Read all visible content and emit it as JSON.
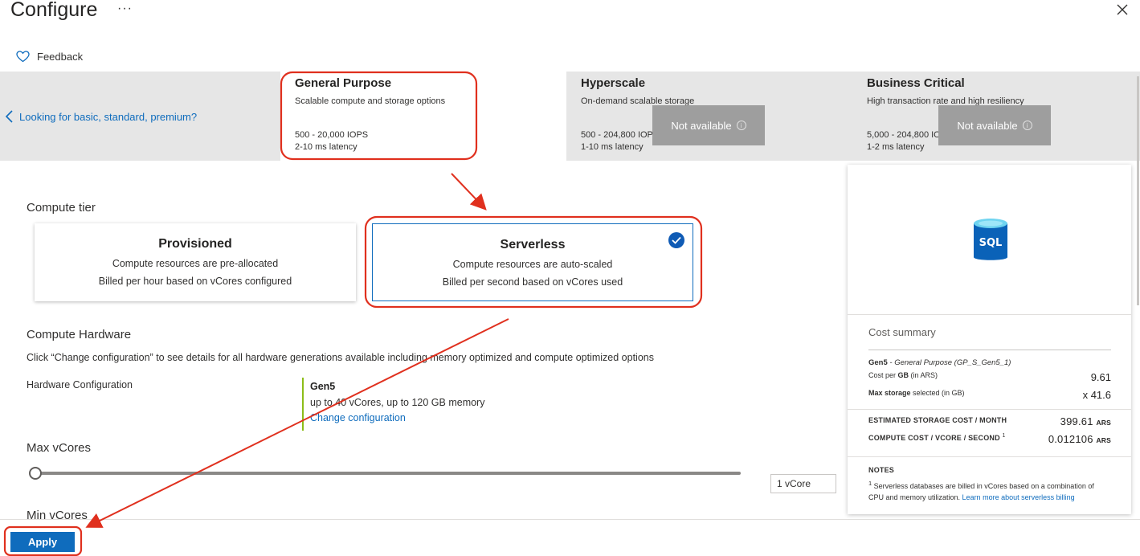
{
  "header": {
    "title": "Configure",
    "more": "···",
    "feedback": "Feedback"
  },
  "tiers": {
    "back_link": "Looking for basic, standard, premium?",
    "items": [
      {
        "name": "General Purpose",
        "desc": "Scalable compute and storage options",
        "iops": "500 - 20,000 IOPS",
        "latency": "2-10 ms latency"
      },
      {
        "name": "Hyperscale",
        "desc": "On-demand scalable storage",
        "iops": "500 - 204,800 IOPS",
        "latency": "1-10 ms latency",
        "status": "Not available"
      },
      {
        "name": "Business Critical",
        "desc": "High transaction rate and high resiliency",
        "iops": "5,000 - 204,800 IOPS",
        "latency": "1-2 ms latency",
        "status": "Not available"
      }
    ]
  },
  "compute_tier": {
    "label": "Compute tier",
    "options": [
      {
        "title": "Provisioned",
        "line1": "Compute resources are pre-allocated",
        "line2": "Billed per hour based on vCores configured"
      },
      {
        "title": "Serverless",
        "line1": "Compute resources are auto-scaled",
        "line2": "Billed per second based on vCores used"
      }
    ]
  },
  "hardware": {
    "label": "Compute Hardware",
    "hint": "Click “Change configuration” to see details for all hardware generations available including memory optimized and compute optimized options",
    "config_label": "Hardware Configuration",
    "gen": "Gen5",
    "desc": "up to 40 vCores, up to 120 GB memory",
    "change_link": "Change configuration"
  },
  "max_vcores": {
    "label": "Max vCores",
    "value": "1 vCore",
    "fraction": 0
  },
  "min_vcores": {
    "label": "Min vCores"
  },
  "footer": {
    "apply": "Apply"
  },
  "cost_summary": {
    "logo_text": "SQL",
    "title": "Cost summary",
    "gen_label": "Gen5",
    "gen_detail": " - General Purpose (GP_S_Gen5_1)",
    "cost_per_gb_label": "Cost per ",
    "cost_per_gb_unit": "GB",
    "cost_per_gb_suffix": " (in ARS)",
    "cost_per_gb_value": "9.61",
    "max_storage_label": "Max storage",
    "max_storage_suffix": " selected (in GB)",
    "max_storage_value": "x 41.6",
    "est_storage_label": "ESTIMATED STORAGE COST / MONTH",
    "est_storage_value": "399.61",
    "compute_label": "COMPUTE COST / VCORE / SECOND",
    "compute_sup": "1",
    "compute_value": "0.012106",
    "currency": "ARS",
    "notes_title": "NOTES",
    "note_sup": "1",
    "note_text": " Serverless databases are billed in vCores based on a combination of CPU and memory utilization. ",
    "note_link": "Learn more about serverless billing"
  },
  "colors": {
    "accent": "#0f6cbd",
    "annotation": "#e0301e",
    "hardware_bar": "#8cbd18"
  }
}
